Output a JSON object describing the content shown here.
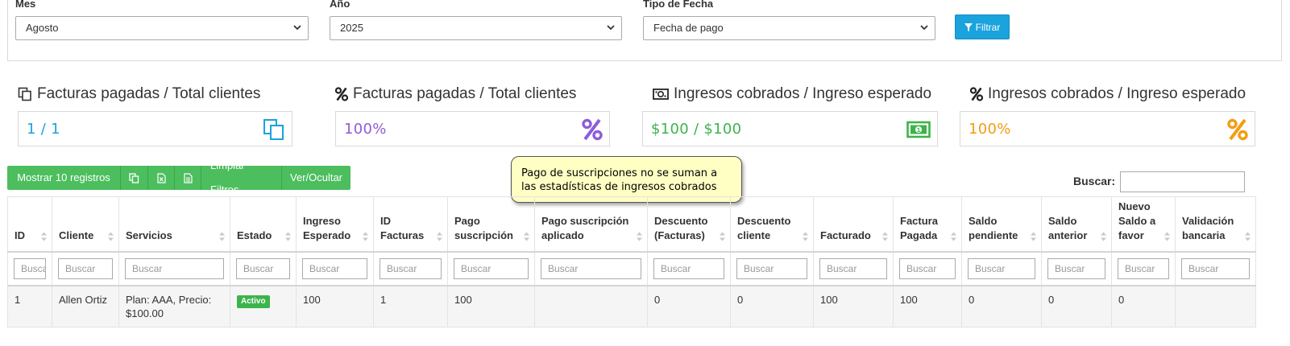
{
  "filters": {
    "month": {
      "label": "Mes",
      "value": "Agosto"
    },
    "year": {
      "label": "Año",
      "value": "2025"
    },
    "date_type": {
      "label": "Tipo de Fecha",
      "value": "Fecha de pago"
    },
    "filter_button": "Filtrar"
  },
  "stats": [
    {
      "title": "Facturas pagadas / Total clientes",
      "value": "1 / 1",
      "color": "#1aa3dc",
      "icon": "copy-icon"
    },
    {
      "title": "Facturas pagadas / Total clientes",
      "value": "100%",
      "color": "#8e5cd9",
      "icon": "percent-icon"
    },
    {
      "title": "Ingresos cobrados / Ingreso esperado",
      "value": "$100 / $100",
      "color": "#3cb44b",
      "icon": "money-icon"
    },
    {
      "title": "Ingresos cobrados / Ingreso esperado",
      "value": "100%",
      "color": "#f39c12",
      "icon": "percent-icon"
    }
  ],
  "toolbar": {
    "show_records": "Mostrar 10 registros",
    "clear_filters": "Limpiar Filtros",
    "toggle_columns": "Ver/Ocultar"
  },
  "tooltip": {
    "line1": "Pago de suscripciones no se suman a",
    "line2": "las estadísticas de ingresos cobrados"
  },
  "search": {
    "label": "Buscar:"
  },
  "table": {
    "columns": [
      {
        "l1": "",
        "l2": "ID"
      },
      {
        "l1": "",
        "l2": "Cliente"
      },
      {
        "l1": "",
        "l2": "Servicios"
      },
      {
        "l1": "",
        "l2": "Estado"
      },
      {
        "l1": "Ingreso",
        "l2": "Esperado"
      },
      {
        "l1": "ID",
        "l2": "Facturas"
      },
      {
        "l1": "Pago",
        "l2": "suscripción"
      },
      {
        "l1": "Pago suscripción",
        "l2": "aplicado"
      },
      {
        "l1": "Descuento",
        "l2": "(Facturas)"
      },
      {
        "l1": "Descuento",
        "l2": "cliente"
      },
      {
        "l1": "",
        "l2": "Facturado"
      },
      {
        "l1": "Factura",
        "l2": "Pagada"
      },
      {
        "l1": "Saldo",
        "l2": "pendiente"
      },
      {
        "l1": "Saldo",
        "l2": "anterior"
      },
      {
        "l0": "Nuevo",
        "l1": "Saldo a",
        "l2": "favor"
      },
      {
        "l1": "Validación",
        "l2": "bancaria"
      }
    ],
    "filter_placeholder": "Buscar",
    "rows": [
      {
        "id": "1",
        "cliente": "Allen Ortiz",
        "servicios_l1": "Plan: AAA, Precio:",
        "servicios_l2": "$100.00",
        "estado": "Activo",
        "ingreso_esperado": "100",
        "id_facturas": "1",
        "pago_suscripcion": "100",
        "pago_suscripcion_aplicado": "",
        "descuento_facturas": "0",
        "descuento_cliente": "0",
        "facturado": "100",
        "factura_pagada": "100",
        "saldo_pendiente": "0",
        "saldo_anterior": "0",
        "nuevo_saldo_favor": "0",
        "validacion_bancaria": ""
      }
    ]
  }
}
